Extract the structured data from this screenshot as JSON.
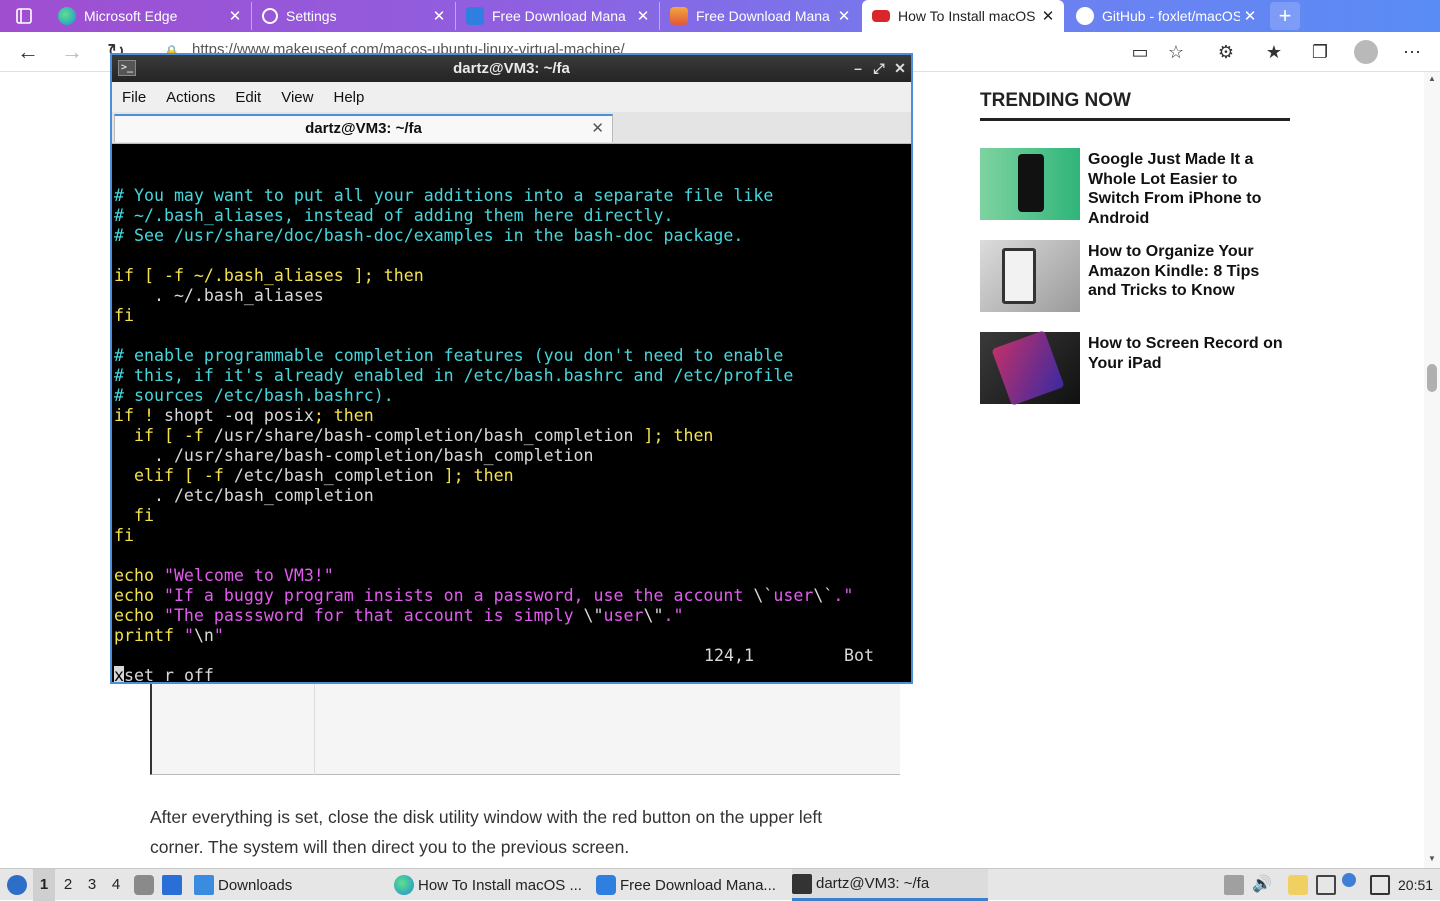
{
  "browser": {
    "tabs": [
      {
        "title": "Microsoft Edge",
        "icon": "edge-icon"
      },
      {
        "title": "Settings",
        "icon": "gear-icon"
      },
      {
        "title": "Free Download Mana",
        "icon": "fdm-icon"
      },
      {
        "title": "Free Download Mana",
        "icon": "fdm-store-icon"
      },
      {
        "title": "How To Install macOS",
        "icon": "muo-icon"
      },
      {
        "title": "GitHub - foxlet/macOS",
        "icon": "github-icon"
      }
    ],
    "close_glyph": "✕",
    "new_tab_glyph": "+",
    "url": "https://www.makeuseof.com/macos-ubuntu-linux-virtual-machine/"
  },
  "page": {
    "trending_title": "TRENDING NOW",
    "trending": [
      {
        "title": "Google Just Made It a Whole Lot Easier to Switch From iPhone to Android"
      },
      {
        "title": "How to Organize Your Amazon Kindle: 8 Tips and Tricks to Know"
      },
      {
        "title": "How to Screen Record on Your iPad"
      }
    ],
    "article_text": "After everything is set, close the disk utility window with the red button on the upper left corner. The system will then direct you to the previous screen."
  },
  "terminal": {
    "window_title": "dartz@VM3: ~/fa",
    "menu": [
      "File",
      "Actions",
      "Edit",
      "View",
      "Help"
    ],
    "tab_title": "dartz@VM3: ~/fa",
    "tab_close": "✕",
    "status_position": "124,1",
    "status_scroll": "Bot",
    "lines": [
      [
        {
          "t": "# You may want to put all your additions into a separate file like",
          "c": "c"
        }
      ],
      [
        {
          "t": "# ~/.bash_aliases, instead of adding them here directly.",
          "c": "c"
        }
      ],
      [
        {
          "t": "# See /usr/share/doc/bash-doc/examples in the bash-doc package.",
          "c": "c"
        }
      ],
      [],
      [
        {
          "t": "if [ -f ~/.bash_aliases ]; ",
          "c": "y"
        },
        {
          "t": "then",
          "c": "y"
        }
      ],
      [
        {
          "t": "    . ~/.bash_aliases",
          "c": "w"
        }
      ],
      [
        {
          "t": "fi",
          "c": "y"
        }
      ],
      [],
      [
        {
          "t": "# enable programmable completion features (you don't need to enable",
          "c": "c"
        }
      ],
      [
        {
          "t": "# this, if it's already enabled in /etc/bash.bashrc and /etc/profile",
          "c": "c"
        }
      ],
      [
        {
          "t": "# sources /etc/bash.bashrc).",
          "c": "c"
        }
      ],
      [
        {
          "t": "if ! ",
          "c": "y"
        },
        {
          "t": "shopt -oq posix",
          "c": "w"
        },
        {
          "t": "; then",
          "c": "y"
        }
      ],
      [
        {
          "t": "  if [ -f ",
          "c": "y"
        },
        {
          "t": "/usr/share/bash-completion/bash_completion",
          "c": "w"
        },
        {
          "t": " ]; then",
          "c": "y"
        }
      ],
      [
        {
          "t": "    . /usr/share/bash-completion/bash_completion",
          "c": "w"
        }
      ],
      [
        {
          "t": "  elif [ -f ",
          "c": "y"
        },
        {
          "t": "/etc/bash_completion",
          "c": "w"
        },
        {
          "t": " ]; then",
          "c": "y"
        }
      ],
      [
        {
          "t": "    . /etc/bash_completion",
          "c": "w"
        }
      ],
      [
        {
          "t": "  fi",
          "c": "y"
        }
      ],
      [
        {
          "t": "fi",
          "c": "y"
        }
      ],
      [],
      [
        {
          "t": "echo ",
          "c": "y"
        },
        {
          "t": "\"Welcome to VM3!\"",
          "c": "m"
        }
      ],
      [
        {
          "t": "echo ",
          "c": "y"
        },
        {
          "t": "\"If a buggy program insists on a password, use the account ",
          "c": "m"
        },
        {
          "t": "\\`",
          "c": "w"
        },
        {
          "t": "user",
          "c": "m"
        },
        {
          "t": "\\`",
          "c": "w"
        },
        {
          "t": ".\"",
          "c": "m"
        }
      ],
      [
        {
          "t": "echo ",
          "c": "y"
        },
        {
          "t": "\"The passsword for that account is simply ",
          "c": "m"
        },
        {
          "t": "\\\"",
          "c": "w"
        },
        {
          "t": "user",
          "c": "m"
        },
        {
          "t": "\\\"",
          "c": "w"
        },
        {
          "t": ".\"",
          "c": "m"
        }
      ],
      [
        {
          "t": "printf ",
          "c": "y"
        },
        {
          "t": "\"",
          "c": "m"
        },
        {
          "t": "\\n",
          "c": "w"
        },
        {
          "t": "\"",
          "c": "m"
        }
      ],
      [],
      [
        {
          "t": "x",
          "c": "cursor"
        },
        {
          "t": "set r off",
          "c": "w"
        }
      ]
    ]
  },
  "taskbar": {
    "workspaces": [
      "1",
      "2",
      "3",
      "4"
    ],
    "active_workspace": "1",
    "tasks": [
      {
        "label": "Downloads"
      },
      {
        "label": "How To Install macOS ..."
      },
      {
        "label": "Free Download Mana..."
      },
      {
        "label": "dartz@VM3: ~/fa"
      }
    ],
    "clock": "20:51"
  },
  "colors": {
    "terminal_comment": "#45d7dc",
    "terminal_keyword": "#f3e24a",
    "terminal_string": "#e35cf0",
    "window_border": "#4a90d9"
  }
}
